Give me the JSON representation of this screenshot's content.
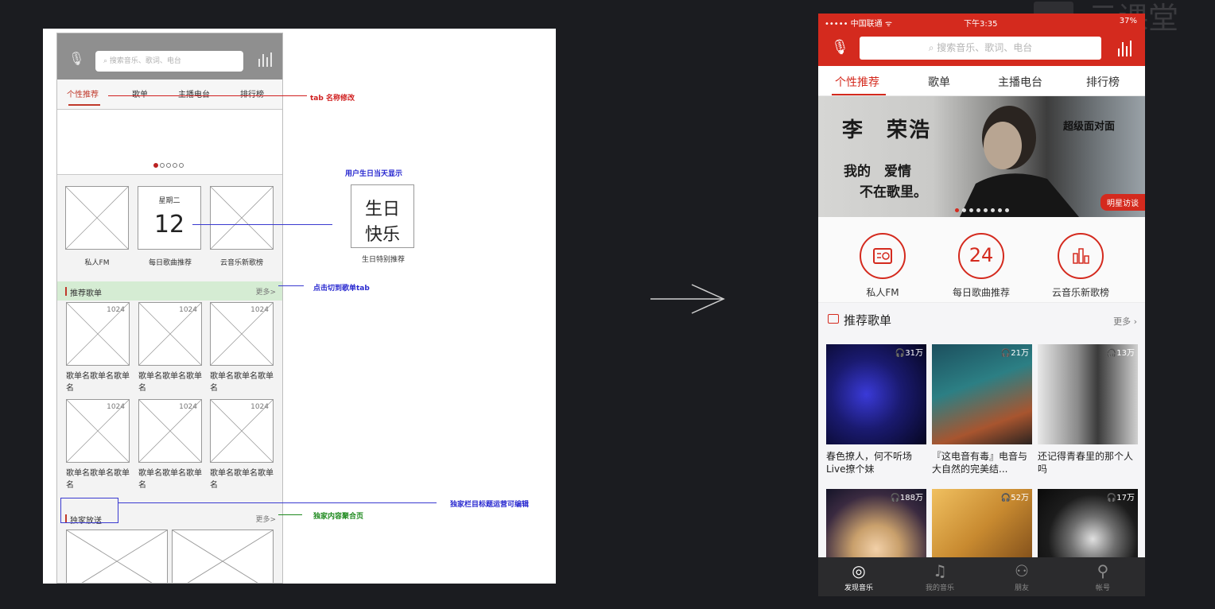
{
  "wireframe": {
    "search_placeholder": "搜索音乐、歌词、电台",
    "tabs": [
      "个性推荐",
      "歌单",
      "主播电台",
      "排行榜"
    ],
    "date": {
      "weekday": "星期二",
      "day": "12"
    },
    "quick_captions": [
      "私人FM",
      "每日歌曲推荐",
      "云音乐新歌榜"
    ],
    "section_recommend": {
      "title": "推荐歌单",
      "more": "更多>"
    },
    "playlist_count": "1024",
    "playlist_names": [
      "歌单名歌单名歌单名",
      "歌单名歌单名歌单名",
      "歌单名歌单名歌单名",
      "歌单名歌单名歌单名",
      "歌单名歌单名歌单名",
      "歌单名歌单名歌单名"
    ],
    "section_exclusive": {
      "title": "独家放送",
      "more": "更多>"
    },
    "birthday": {
      "line1": "生日",
      "line2": "快乐",
      "caption": "生日特别推荐"
    },
    "annotations": {
      "tab_rename": "tab 名称修改",
      "birthday_show": "用户生日当天显示",
      "tap_switch": "点击切到歌单tab",
      "exclusive_title": "独家栏目标题运营可编辑",
      "exclusive_page": "独家内容聚合页"
    }
  },
  "phone": {
    "status": {
      "carrier": "••••• 中国联通 ᯤ",
      "time": "下午3:35",
      "battery": "37%"
    },
    "search_placeholder": "搜索音乐、歌词、电台",
    "tabs": [
      "个性推荐",
      "歌单",
      "主播电台",
      "排行榜"
    ],
    "banner": {
      "name": "李　荣浩",
      "line1": "我的　爱情",
      "line2": "不在歌里。",
      "subtitle": "超级面对面",
      "tag": "明星访谈"
    },
    "quick": [
      {
        "label": "私人FM",
        "icon": "radio-icon"
      },
      {
        "label": "每日歌曲推荐",
        "icon": "calendar-icon",
        "number": "24"
      },
      {
        "label": "云音乐新歌榜",
        "icon": "chart-icon"
      }
    ],
    "section": {
      "title": "推荐歌单",
      "more": "更多 ›"
    },
    "playlists": [
      {
        "name": "春色撩人，何不听场Live撩个妹",
        "plays": "31万"
      },
      {
        "name": "『这电音有毒』电音与大自然的完美结...",
        "plays": "21万"
      },
      {
        "name": "还记得青春里的那个人吗",
        "plays": "13万"
      },
      {
        "name": "",
        "plays": "188万"
      },
      {
        "name": "",
        "plays": "52万"
      },
      {
        "name": "",
        "plays": "17万"
      }
    ],
    "tabbar": [
      "发现音乐",
      "我的音乐",
      "朋友",
      "帐号"
    ]
  },
  "colors": {
    "brand_red": "#d42a1e",
    "background": "#1b1c20"
  }
}
